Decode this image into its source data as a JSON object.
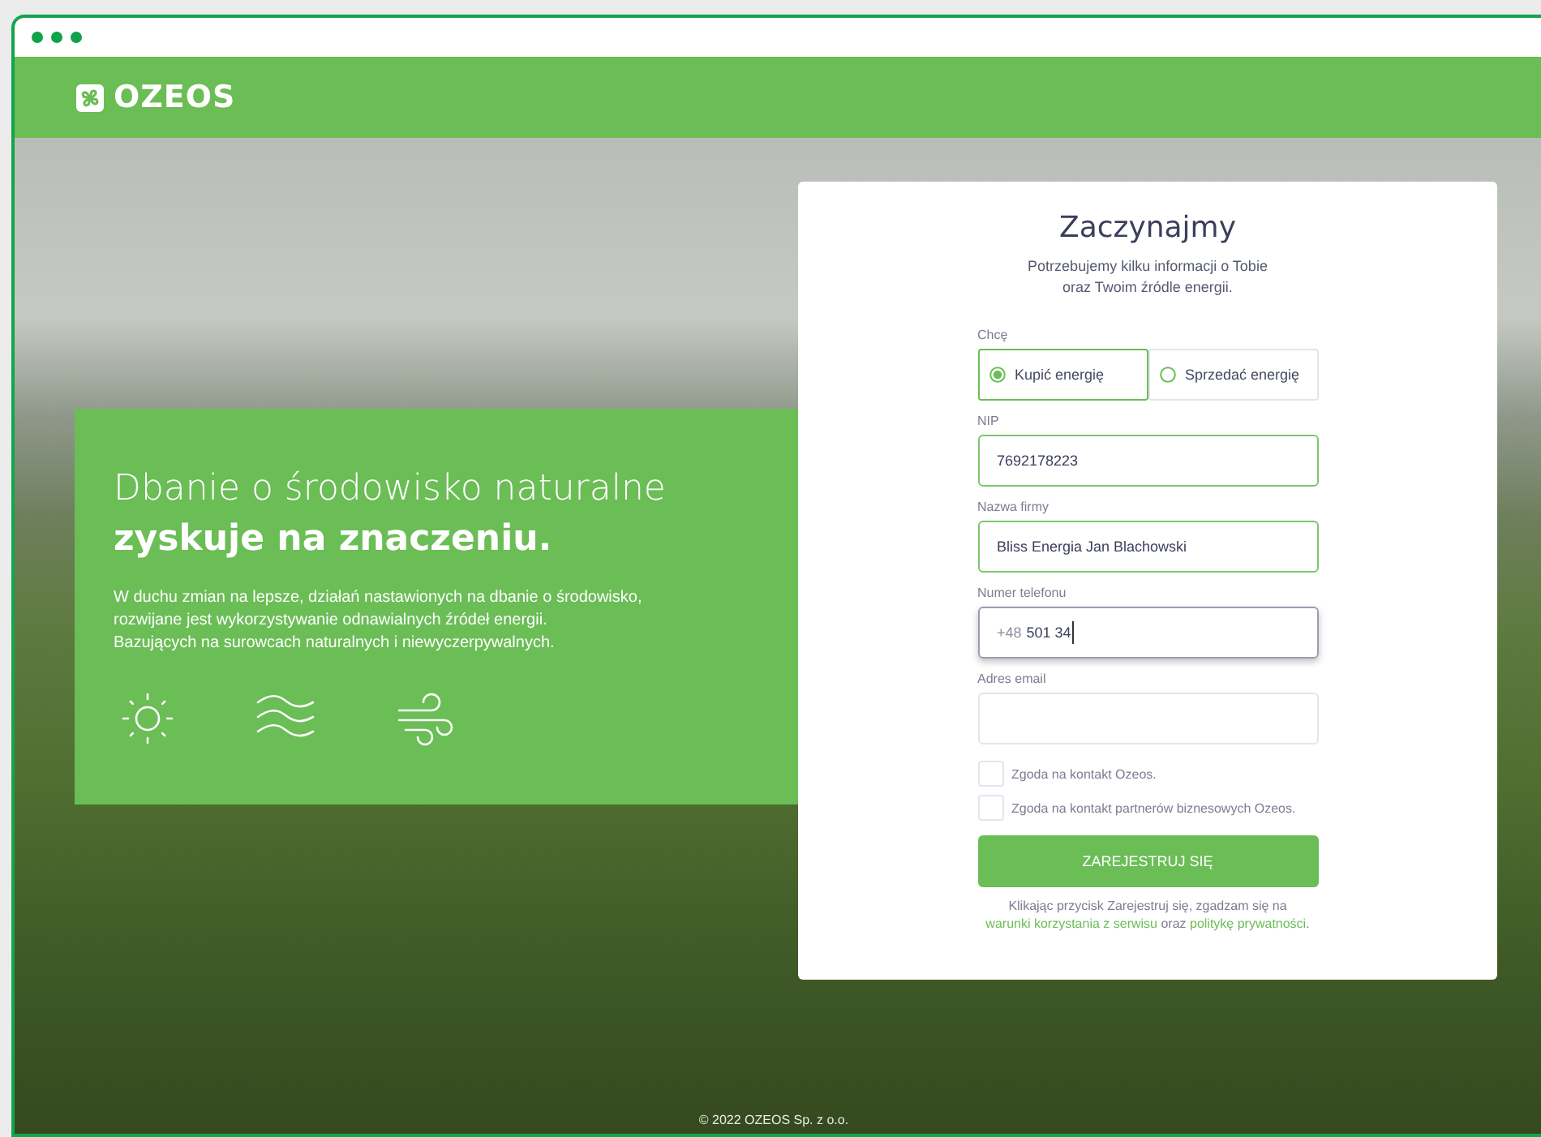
{
  "header": {
    "logo_text": "OZEOS"
  },
  "hero": {
    "title": "Dbanie o środowisko naturalne",
    "title_bold": "zyskuje na znaczeniu.",
    "lines": [
      "W duchu zmian na lepsze, działań nastawionych na dbanie o środowisko,",
      "rozwijane jest wykorzystywanie odnawialnych źródeł energii.",
      "Bazujących na surowcach naturalnych i niewyczerpywalnych."
    ]
  },
  "form": {
    "title": "Zaczynajmy",
    "subtitle": [
      "Potrzebujemy kilku informacji o Tobie",
      "oraz Twoim źródle energii."
    ],
    "choice_label": "Chcę",
    "options": [
      {
        "label": "Kupić energię",
        "selected": true
      },
      {
        "label": "Sprzedać energię",
        "selected": false
      }
    ],
    "fields": [
      {
        "label": "NIP",
        "value": "7692178223",
        "valid": true,
        "focused": false
      },
      {
        "label": "Nazwa firmy",
        "value": "Bliss Energia Jan Blachowski",
        "valid": true,
        "focused": false
      },
      {
        "label": "Numer telefonu",
        "prefix": "+48",
        "value": "501 34",
        "valid": false,
        "focused": true
      },
      {
        "label": "Adres email",
        "valid": false,
        "focused": false
      }
    ],
    "consents": [
      {
        "label": "Zgoda na kontakt Ozeos.",
        "checked": false
      },
      {
        "label": "Zgoda na kontakt partnerów biznesowych Ozeos.",
        "checked": false
      }
    ],
    "submit": "ZAREJESTRUJ SIĘ",
    "legal": [
      {
        "kind": "text",
        "text": "Klikając przycisk Zarejestruj się, zgadzam się na "
      },
      {
        "kind": "link",
        "text": "warunki korzystania z serwisu"
      },
      {
        "kind": "text",
        "text": " oraz "
      },
      {
        "kind": "link",
        "text": "politykę prywatności"
      },
      {
        "kind": "text",
        "text": "."
      }
    ]
  },
  "footer": "© 2022 OZEOS Sp. z o.o."
}
